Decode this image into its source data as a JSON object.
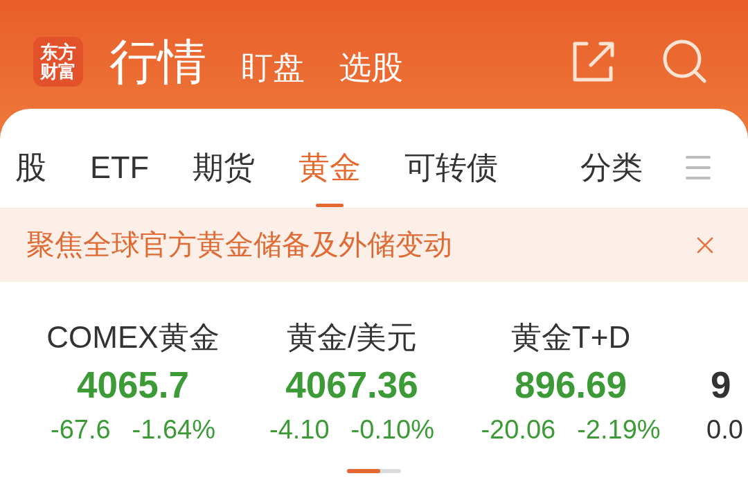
{
  "header": {
    "logo": {
      "lines": [
        "东方",
        "财富"
      ]
    },
    "nav": [
      {
        "label": "行情",
        "selected": true
      },
      {
        "label": "盯盘",
        "selected": false
      },
      {
        "label": "选股",
        "selected": false
      }
    ]
  },
  "tabs": [
    {
      "label": "股",
      "selected": false
    },
    {
      "label": "ETF",
      "selected": false
    },
    {
      "label": "期货",
      "selected": false
    },
    {
      "label": "黄金",
      "selected": true
    },
    {
      "label": "可转债",
      "selected": false
    }
  ],
  "category_button": {
    "label": "分类"
  },
  "banner": {
    "text": "聚焦全球官方黄金储备及外储变动"
  },
  "tickers": [
    {
      "name": "COMEX黄金",
      "price": "4065.7",
      "change": "-67.6",
      "change_percent": "-1.64%",
      "color": "#3d9b37"
    },
    {
      "name": "黄金/美元",
      "price": "4067.36",
      "change": "-4.10",
      "change_percent": "-0.10%",
      "color": "#3d9b37"
    },
    {
      "name": "黄金T+D",
      "price": "896.69",
      "change": "-20.06",
      "change_percent": "-2.19%",
      "color": "#3d9b37"
    },
    {
      "price": "9",
      "change": "0.0",
      "color": "#333333"
    }
  ]
}
